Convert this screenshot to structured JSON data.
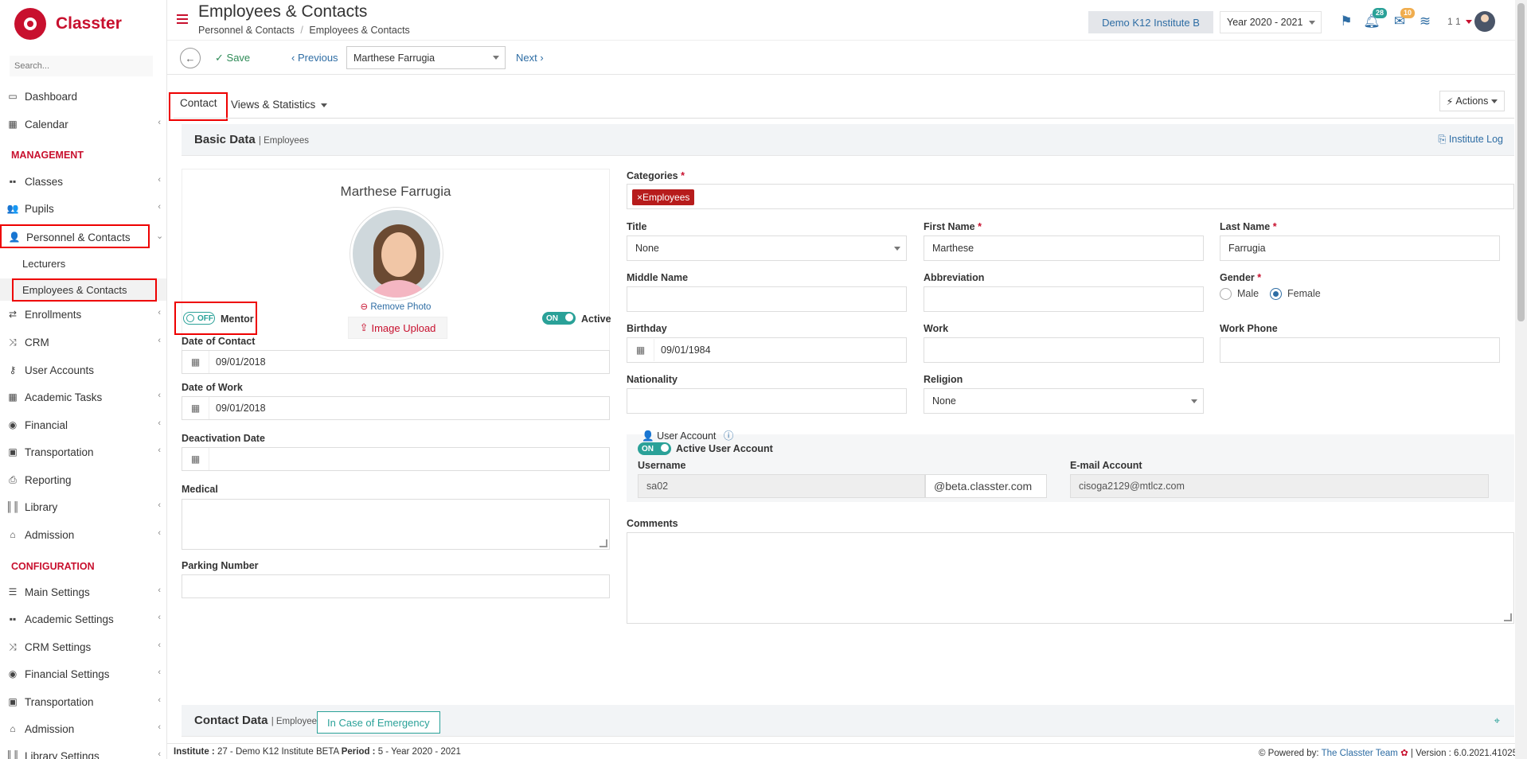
{
  "app": {
    "logo_text": "Classter",
    "search_placeholder": "Search..."
  },
  "sidebar": {
    "items": [
      {
        "label": "Dashboard",
        "icon": "laptop-icon"
      },
      {
        "label": "Calendar",
        "icon": "calendar-icon"
      },
      {
        "label": "Classes",
        "icon": "classes-icon"
      },
      {
        "label": "Pupils",
        "icon": "users-icon"
      },
      {
        "label": "Personnel & Contacts",
        "icon": "person-icon"
      },
      {
        "label": "Enrollments",
        "icon": "exchange-icon"
      },
      {
        "label": "CRM",
        "icon": "random-icon"
      },
      {
        "label": "User Accounts",
        "icon": "key-icon"
      },
      {
        "label": "Academic Tasks",
        "icon": "grid-icon"
      },
      {
        "label": "Financial",
        "icon": "coins-icon"
      },
      {
        "label": "Transportation",
        "icon": "bus-icon"
      },
      {
        "label": "Reporting",
        "icon": "print-icon"
      },
      {
        "label": "Library",
        "icon": "books-icon"
      },
      {
        "label": "Admission",
        "icon": "bank-icon"
      },
      {
        "label": "Main Settings",
        "icon": "sliders-icon"
      },
      {
        "label": "Academic Settings",
        "icon": "classes-icon"
      },
      {
        "label": "CRM Settings",
        "icon": "random-icon"
      },
      {
        "label": "Financial Settings",
        "icon": "coins-icon"
      },
      {
        "label": "Transportation",
        "icon": "bus-icon"
      },
      {
        "label": "Admission",
        "icon": "bank-icon"
      },
      {
        "label": "Library Settings",
        "icon": "books-icon"
      }
    ],
    "sections": {
      "management": "MANAGEMENT",
      "configuration": "CONFIGURATION"
    },
    "sub_items": {
      "lecturers": "Lecturers",
      "employees": "Employees & Contacts"
    }
  },
  "header": {
    "title": "Employees & Contacts",
    "breadcrumb": [
      "Personnel & Contacts",
      "/",
      "Employees & Contacts"
    ],
    "institute": "Demo K12 Institute B",
    "year": "Year 2020 - 2021",
    "notif_count": "28",
    "message_count": "10",
    "user_num": "1 1"
  },
  "toolbar": {
    "save_label": "Save",
    "previous_label": "Previous",
    "person": "Marthese Farrugia",
    "next_label": "Next"
  },
  "tabs": {
    "contact": "Contact",
    "views": "Views & Statistics",
    "actions": "Actions"
  },
  "basic_data": {
    "title": "Basic Data",
    "sub": "| Employees",
    "institute_log": "Institute Log",
    "person_name": "Marthese Farrugia",
    "remove_photo": "Remove Photo",
    "image_upload": "Image Upload",
    "mentor_toggle": "OFF",
    "mentor_label": "Mentor",
    "active_toggle": "ON",
    "active_label": "Active",
    "date_of_contact_label": "Date of Contact",
    "date_of_contact": "09/01/2018",
    "date_of_work_label": "Date of Work",
    "date_of_work": "09/01/2018",
    "deactivation_label": "Deactivation Date",
    "deactivation": "",
    "medical_label": "Medical",
    "parking_label": "Parking Number",
    "parking": ""
  },
  "form": {
    "categories_label": "Categories",
    "category_tag": "×Employees",
    "title_label": "Title",
    "title_value": "None",
    "first_name_label": "First Name",
    "first_name": "Marthese",
    "last_name_label": "Last Name",
    "last_name": "Farrugia",
    "middle_name_label": "Middle Name",
    "middle_name": "",
    "abbreviation_label": "Abbreviation",
    "abbreviation": "",
    "gender_label": "Gender",
    "gender_male": "Male",
    "gender_female": "Female",
    "birthday_label": "Birthday",
    "birthday": "09/01/1984",
    "work_label": "Work",
    "work": "",
    "work_phone_label": "Work Phone",
    "work_phone": "",
    "nationality_label": "Nationality",
    "nationality": "",
    "religion_label": "Religion",
    "religion": "None",
    "user_account_label": "User Account",
    "active_account_toggle": "ON",
    "active_account_label": "Active User Account",
    "username_label": "Username",
    "username": "sa02",
    "domain": "@beta.classter.com",
    "email_label": "E-mail Account",
    "email": "cisoga2129@mtlcz.com",
    "comments_label": "Comments"
  },
  "contact_data": {
    "title": "Contact Data",
    "sub": "| Employees",
    "emergency": "In Case of Emergency"
  },
  "footer": {
    "institute_label": "Institute :",
    "institute_value": " 27 - Demo K12 Institute BETA ",
    "period_label": "Period :",
    "period_value": " 5 - Year 2020 - 2021",
    "powered": "Powered by: ",
    "team": "The Classter Team",
    "version": " | Version : 6.0.2021.41025"
  },
  "colors": {
    "brand": "#c8102e",
    "link": "#2e6da4",
    "teal": "#2aa198"
  }
}
